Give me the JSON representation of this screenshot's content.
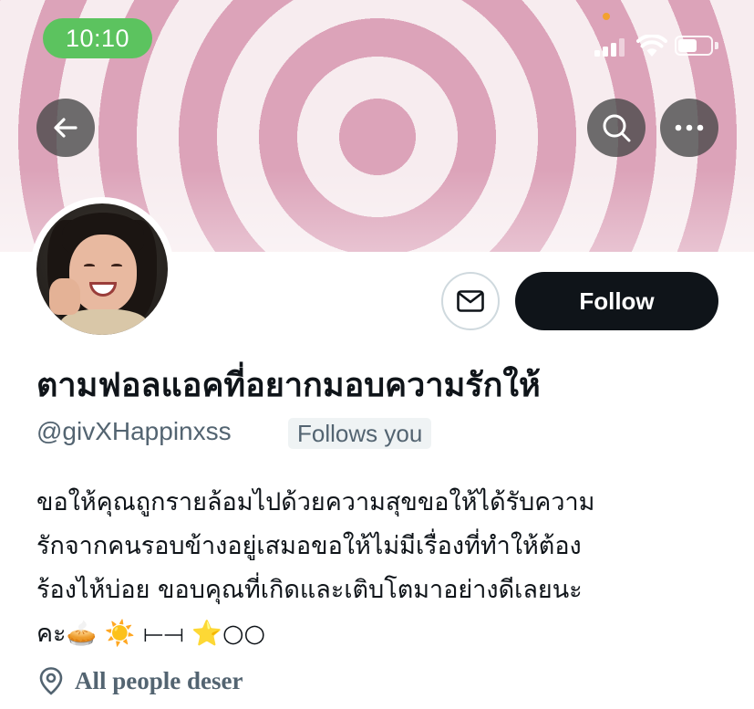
{
  "status_bar": {
    "time": "10:10"
  },
  "banner": {
    "back_icon": "arrow-left-icon",
    "search_icon": "search-icon",
    "more_icon": "more-horizontal-icon"
  },
  "profile": {
    "display_name": "ตามฟอลแอคที่อยากมอบความรักให้",
    "handle": "@givXHappinxss",
    "follows_you": "Follows you",
    "follow_label": "Follow",
    "message_icon": "mail-icon",
    "bio_lines": [
      "ขอให้คุณถูกรายล้อมไปด้วยความสุขขอให้ได้รับความ",
      "รักจากคนรอบข้างอยู่เสมอขอให้ไม่มีเรื่องที่ทำให้ต้อง",
      "ร้องไห้บ่อย ขอบคุณที่เกิดและเติบโตมาอย่างดีเลยนะ",
      "คะ🥧 ☀️ ⟝⟞ ⭐○○"
    ],
    "location": "All people deser",
    "location_icon": "location-pin-icon"
  },
  "colors": {
    "time_pill": "#5cc35f",
    "follow_button": "#0f1419",
    "secondary_text": "#536471",
    "banner_pink": "#dca3b9"
  }
}
